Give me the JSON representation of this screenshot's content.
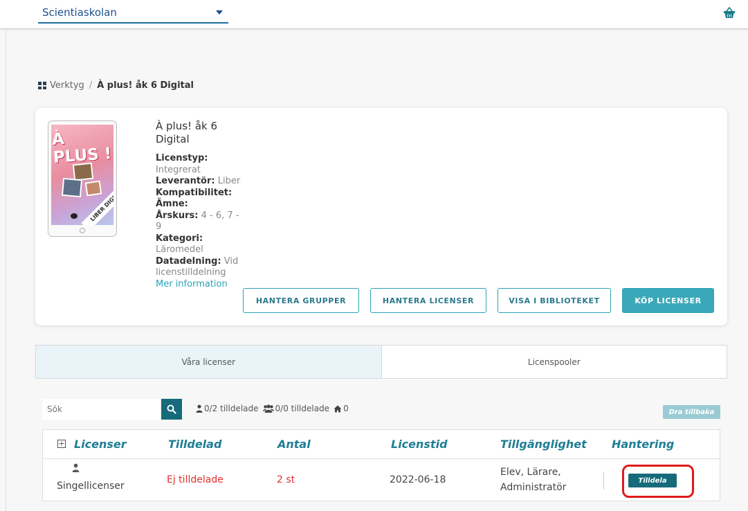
{
  "header": {
    "school": "Scientiaskolan"
  },
  "breadcrumb": {
    "root": "Verktyg",
    "separator": "/",
    "current": "À plus! åk 6 Digital"
  },
  "product": {
    "title_line1": "À plus! åk 6",
    "title_line2": "Digital",
    "cover_title": "À PLUS !",
    "cover_ribbon": "LIBER DIGITAL",
    "fields": {
      "licenstyp_label": "Licenstyp:",
      "licenstyp_value": "Integrerat",
      "leverantor_label": "Leverantör:",
      "leverantor_value": "Liber",
      "kompatibilitet_label": "Kompatibilitet:",
      "amne_label": "Ämne:",
      "arskurs_label": "Årskurs:",
      "arskurs_value": "4 - 6, 7 - 9",
      "kategori_label": "Kategori:",
      "kategori_value": "Läromedel",
      "datadelning_label": "Datadelning:",
      "datadelning_value_1": "Vid",
      "datadelning_value_2": "licenstilldelning"
    },
    "more_info": "Mer information"
  },
  "actions": {
    "hantera_grupper": "HANTERA GRUPPER",
    "hantera_licenser": "HANTERA LICENSER",
    "visa_i_biblioteket": "VISA I BIBLIOTEKET",
    "kop_licenser": "KÖP LICENSER"
  },
  "tabs": {
    "vara_licenser": "Våra licenser",
    "licenspooler": "Licenspooler"
  },
  "toolbar": {
    "search_placeholder": "Sök",
    "stat_users": "0/2 tilldelade",
    "stat_groups": "0/0 tilldelade",
    "stat_schools": "0",
    "dra_tillbaka": "Dra tillbaka"
  },
  "table": {
    "headers": {
      "licenser": "Licenser",
      "tilldelad": "Tilldelad",
      "antal": "Antal",
      "licenstid": "Licenstid",
      "tillganglighet": "Tillgänglighet",
      "hantering": "Hantering"
    },
    "rows": [
      {
        "type": "Singellicenser",
        "tilldelad": "Ej tilldelade",
        "antal": "2 st",
        "licenstid": "2022-06-18",
        "tillganglighet_1": "Elev, Lärare,",
        "tillganglighet_2": "Administratör",
        "action": "Tilldela"
      }
    ]
  },
  "colors": {
    "accent": "#2aa3b5",
    "dark_teal": "#156b7a",
    "header_text": "#1f7e94",
    "alert": "#e03030",
    "highlight": "#e01a1a"
  }
}
